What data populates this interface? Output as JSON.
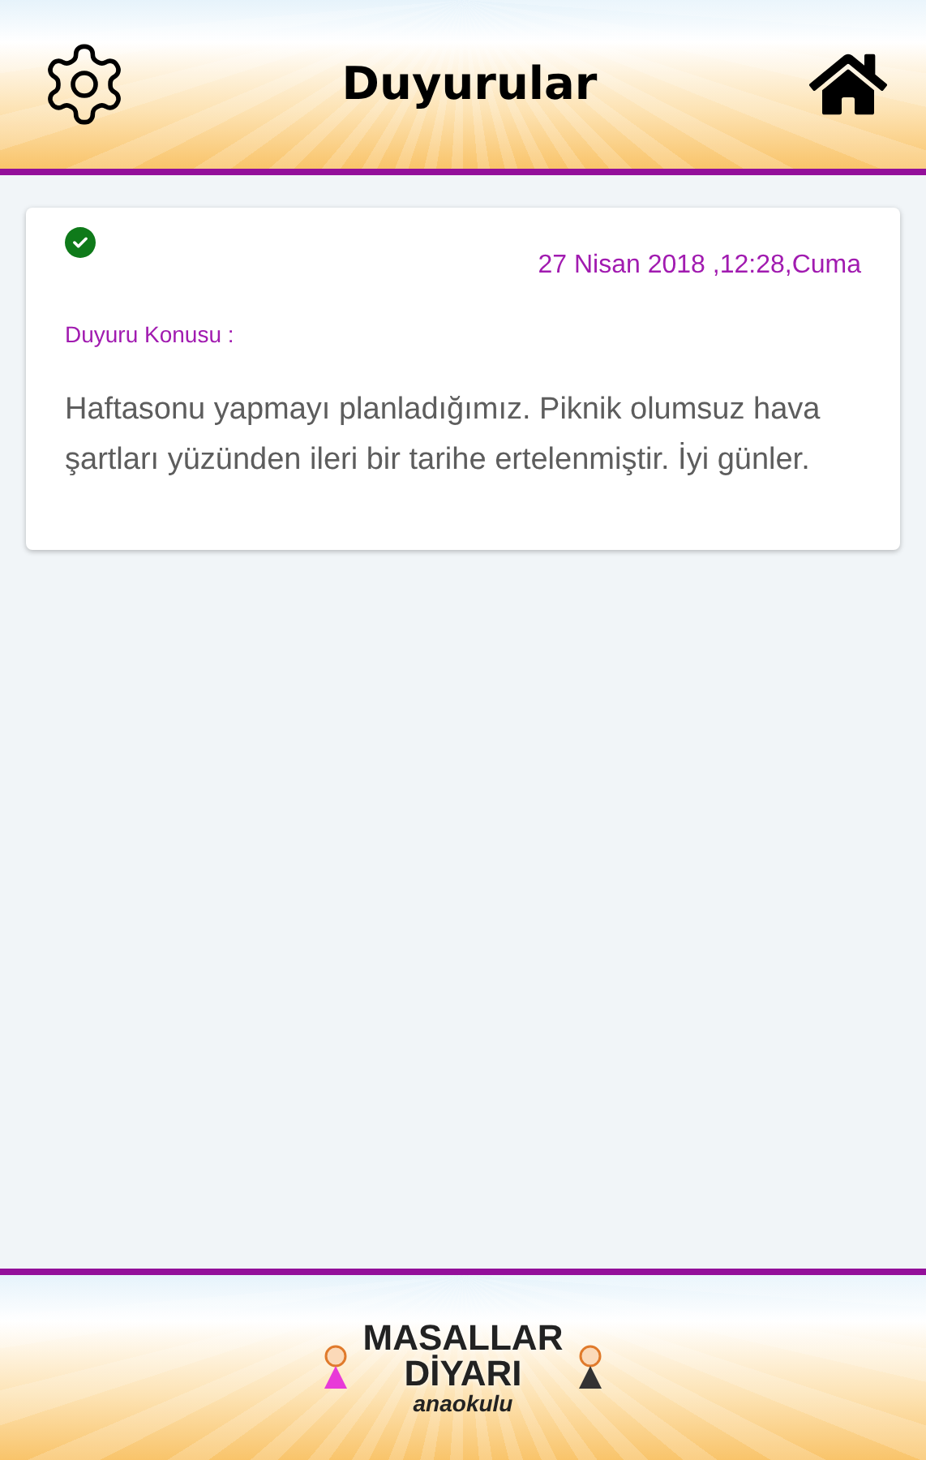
{
  "header": {
    "title": "Duyurular"
  },
  "announcements": [
    {
      "read": true,
      "date": "27 Nisan 2018 ,12:28,Cuma",
      "subject_label": "Duyuru Konusu :",
      "body": "Haftasonu yapmayı planladığımız. Piknik olumsuz hava şartları yüzünden ileri bir tarihe ertelenmiştir. İyi günler."
    }
  ],
  "footer": {
    "logo_lines": [
      "MASALLAR",
      "DİYARI",
      "anaokulu"
    ]
  }
}
